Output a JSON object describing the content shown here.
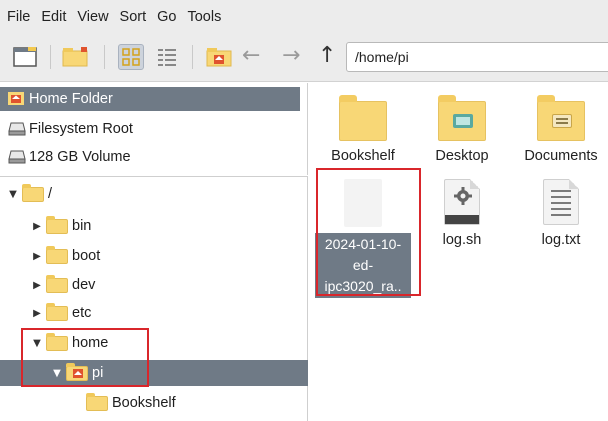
{
  "menubar": {
    "items": [
      "File",
      "Edit",
      "View",
      "Sort",
      "Go",
      "Tools"
    ]
  },
  "toolbar": {
    "path": "/home/pi",
    "buttons": [
      "new-window-icon",
      "new-folder-icon",
      "icon-view-icon",
      "list-view-icon",
      "home-icon",
      "back-arrow-icon",
      "forward-arrow-icon",
      "up-arrow-icon"
    ],
    "back_glyph": "←",
    "forward_glyph": "→",
    "up_glyph": "↑"
  },
  "places": [
    {
      "label": "Home Folder",
      "icon": "home-folder-icon",
      "active": true
    },
    {
      "label": "Filesystem Root",
      "icon": "drive-icon",
      "active": false
    },
    {
      "label": "128 GB Volume",
      "icon": "drive-icon",
      "active": false
    }
  ],
  "tree": {
    "root": "/",
    "items": [
      {
        "label": "bin",
        "expanded": false
      },
      {
        "label": "boot",
        "expanded": false
      },
      {
        "label": "dev",
        "expanded": false
      },
      {
        "label": "etc",
        "expanded": false
      },
      {
        "label": "home",
        "expanded": true
      },
      {
        "label": "pi",
        "expanded": true,
        "selected": true
      },
      {
        "label": "Bookshelf"
      }
    ]
  },
  "files": [
    {
      "name": "Bookshelf",
      "type": "folder"
    },
    {
      "name": "Desktop",
      "type": "folder"
    },
    {
      "name": "Documents",
      "type": "folder"
    },
    {
      "name": "2024-01-10-ed-ipc3020_ra..",
      "name_lines": [
        "2024-01-10-",
        "ed-",
        "ipc3020_ra.."
      ],
      "type": "file",
      "selected": true
    },
    {
      "name": "log.sh",
      "type": "script"
    },
    {
      "name": "log.txt",
      "type": "text"
    }
  ],
  "colors": {
    "selection": "#6f7a86",
    "folder": "#f8d776",
    "highlight_box": "#d9262b"
  }
}
